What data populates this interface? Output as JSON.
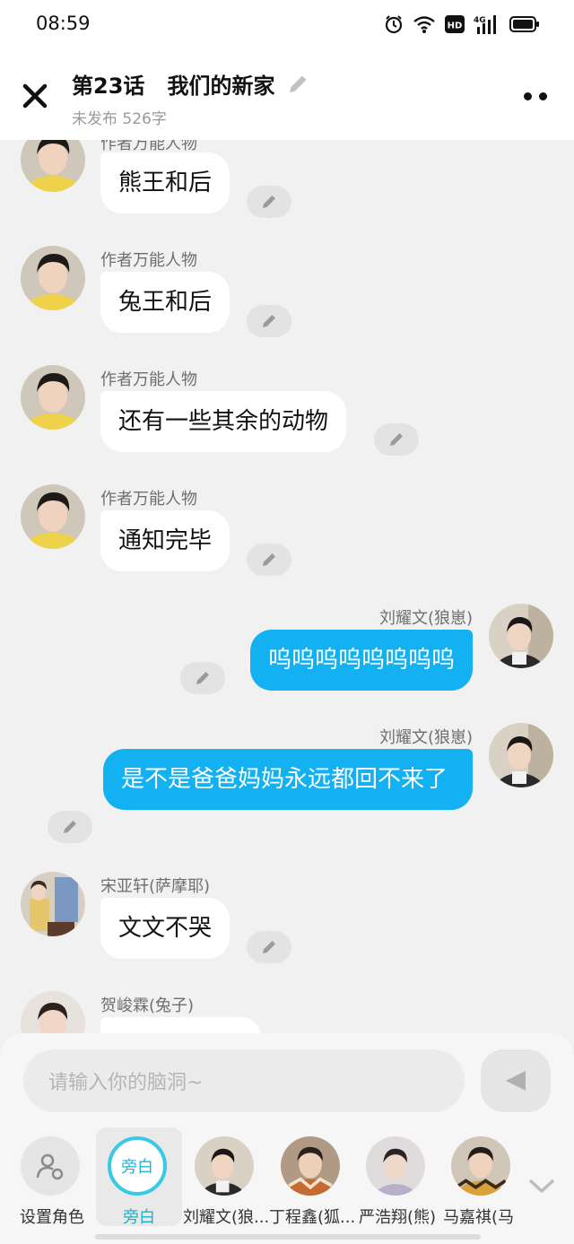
{
  "status": {
    "time": "08:59",
    "hd": "HD",
    "network": "4G"
  },
  "header": {
    "title": "第23话   我们的新家",
    "subtitle": "未发布 526字"
  },
  "messages": [
    {
      "name": "作者万能人物",
      "text": "熊王和后"
    },
    {
      "name": "作者万能人物",
      "text": "兔王和后"
    },
    {
      "name": "作者万能人物",
      "text": "还有一些其余的动物"
    },
    {
      "name": "作者万能人物",
      "text": "通知完毕"
    },
    {
      "name": "刘耀文(狼崽)",
      "text": "呜呜呜呜呜呜呜呜"
    },
    {
      "name": "刘耀文(狼崽)",
      "text": "是不是爸爸妈妈永远都回不来了"
    },
    {
      "name": "宋亚轩(萨摩耶)",
      "text": "文文不哭"
    },
    {
      "name": "贺峻霖(兔子)",
      "text": ""
    }
  ],
  "input": {
    "placeholder": "请输入你的脑洞~"
  },
  "roles": [
    {
      "label": "设置角色"
    },
    {
      "label": "旁白",
      "icon_text": "旁白"
    },
    {
      "label": "刘耀文(狼..."
    },
    {
      "label": "丁程鑫(狐..."
    },
    {
      "label": "严浩翔(熊)"
    },
    {
      "label": "马嘉祺(马"
    }
  ],
  "colors": {
    "accent_bubble": "#14b1f2",
    "narrator_ring": "#39c9e6",
    "page_bg": "#f1f1f1"
  }
}
